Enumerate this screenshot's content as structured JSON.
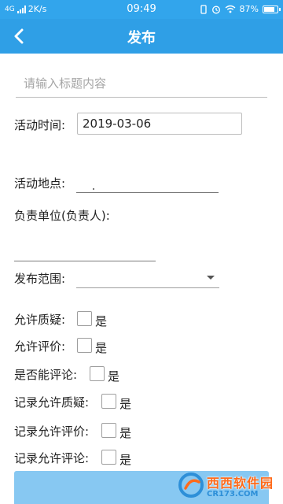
{
  "status_bar": {
    "network": "4G",
    "speed": "2K/s",
    "time": "09:49",
    "battery": "87%",
    "battery_level": 0.87,
    "icons": [
      "signal-icon",
      "vibrate-icon",
      "alarm-icon",
      "wifi-icon",
      "battery-icon"
    ]
  },
  "header": {
    "title": "发布",
    "back_icon": "chevron-left-icon",
    "color": "#2f9fe6"
  },
  "form": {
    "title_placeholder": "请输入标题内容",
    "title_value": "",
    "activity_time_label": "活动时间:",
    "activity_time_value": "2019-03-06",
    "activity_location_label": "活动地点:",
    "activity_location_value": "",
    "responsible_unit_label": "负责单位(负责人):",
    "responsible_unit_value": "",
    "publish_scope_label": "发布范围:",
    "publish_scope_value": "",
    "options": [
      {
        "label": "允许质疑:",
        "yes": "是",
        "checked": false
      },
      {
        "label": "允许评价:",
        "yes": "是",
        "checked": false
      },
      {
        "label": "是否能评论:",
        "yes": "是",
        "checked": false
      },
      {
        "label": "记录允许质疑:",
        "yes": "是",
        "checked": false
      },
      {
        "label": "记录允许评价:",
        "yes": "是",
        "checked": false
      },
      {
        "label": "记录允许评论:",
        "yes": "是",
        "checked": false
      }
    ]
  },
  "submit_color": "#87c8f2",
  "watermark": {
    "title": "西西软件园",
    "url": "CR173.COM"
  }
}
